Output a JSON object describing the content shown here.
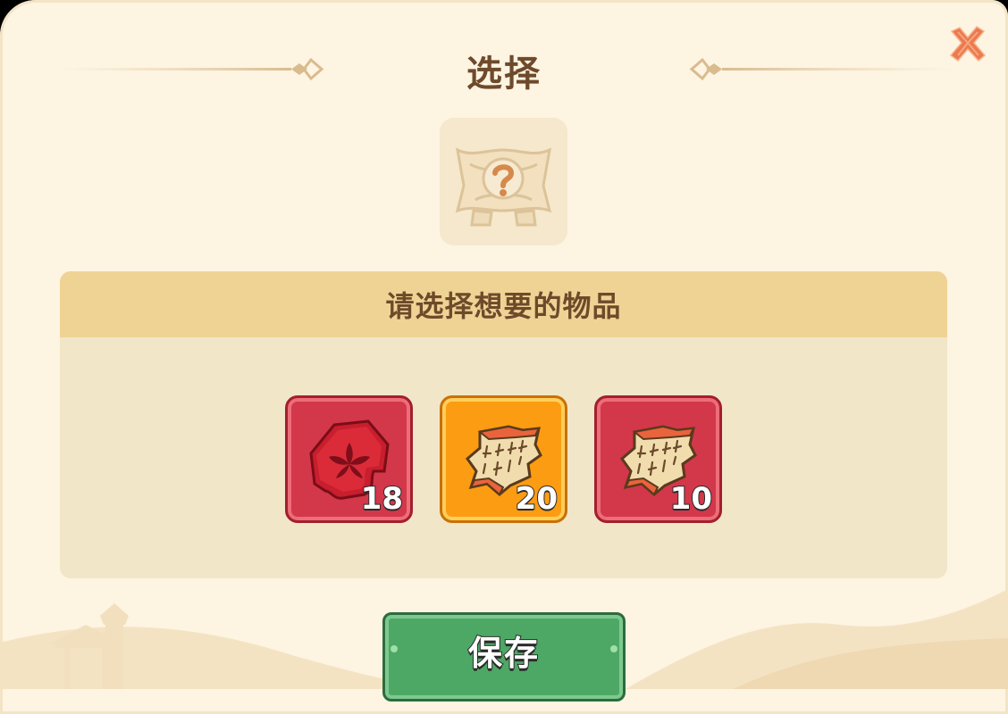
{
  "dialog": {
    "title": "选择",
    "close_icon": "close-x-icon",
    "reward_icon": "mystery-chest-icon"
  },
  "panel": {
    "header": "请选择想要的物品",
    "items": [
      {
        "icon": "red-crest-fragment-icon",
        "count": "18",
        "rarity_color": "#d3374a"
      },
      {
        "icon": "scroll-fragment-icon",
        "count": "20",
        "rarity_color": "#fb9c12"
      },
      {
        "icon": "scroll-fragment-icon",
        "count": "10",
        "rarity_color": "#d3374a"
      }
    ]
  },
  "footer": {
    "save_label": "保存"
  },
  "colors": {
    "background": "#fdf4e2",
    "title_text": "#6e4a2b",
    "panel_header": "#efd394",
    "panel_body": "#f2e6c8",
    "close_accent": "#ec7a4e",
    "save_button": "#4ea865"
  }
}
